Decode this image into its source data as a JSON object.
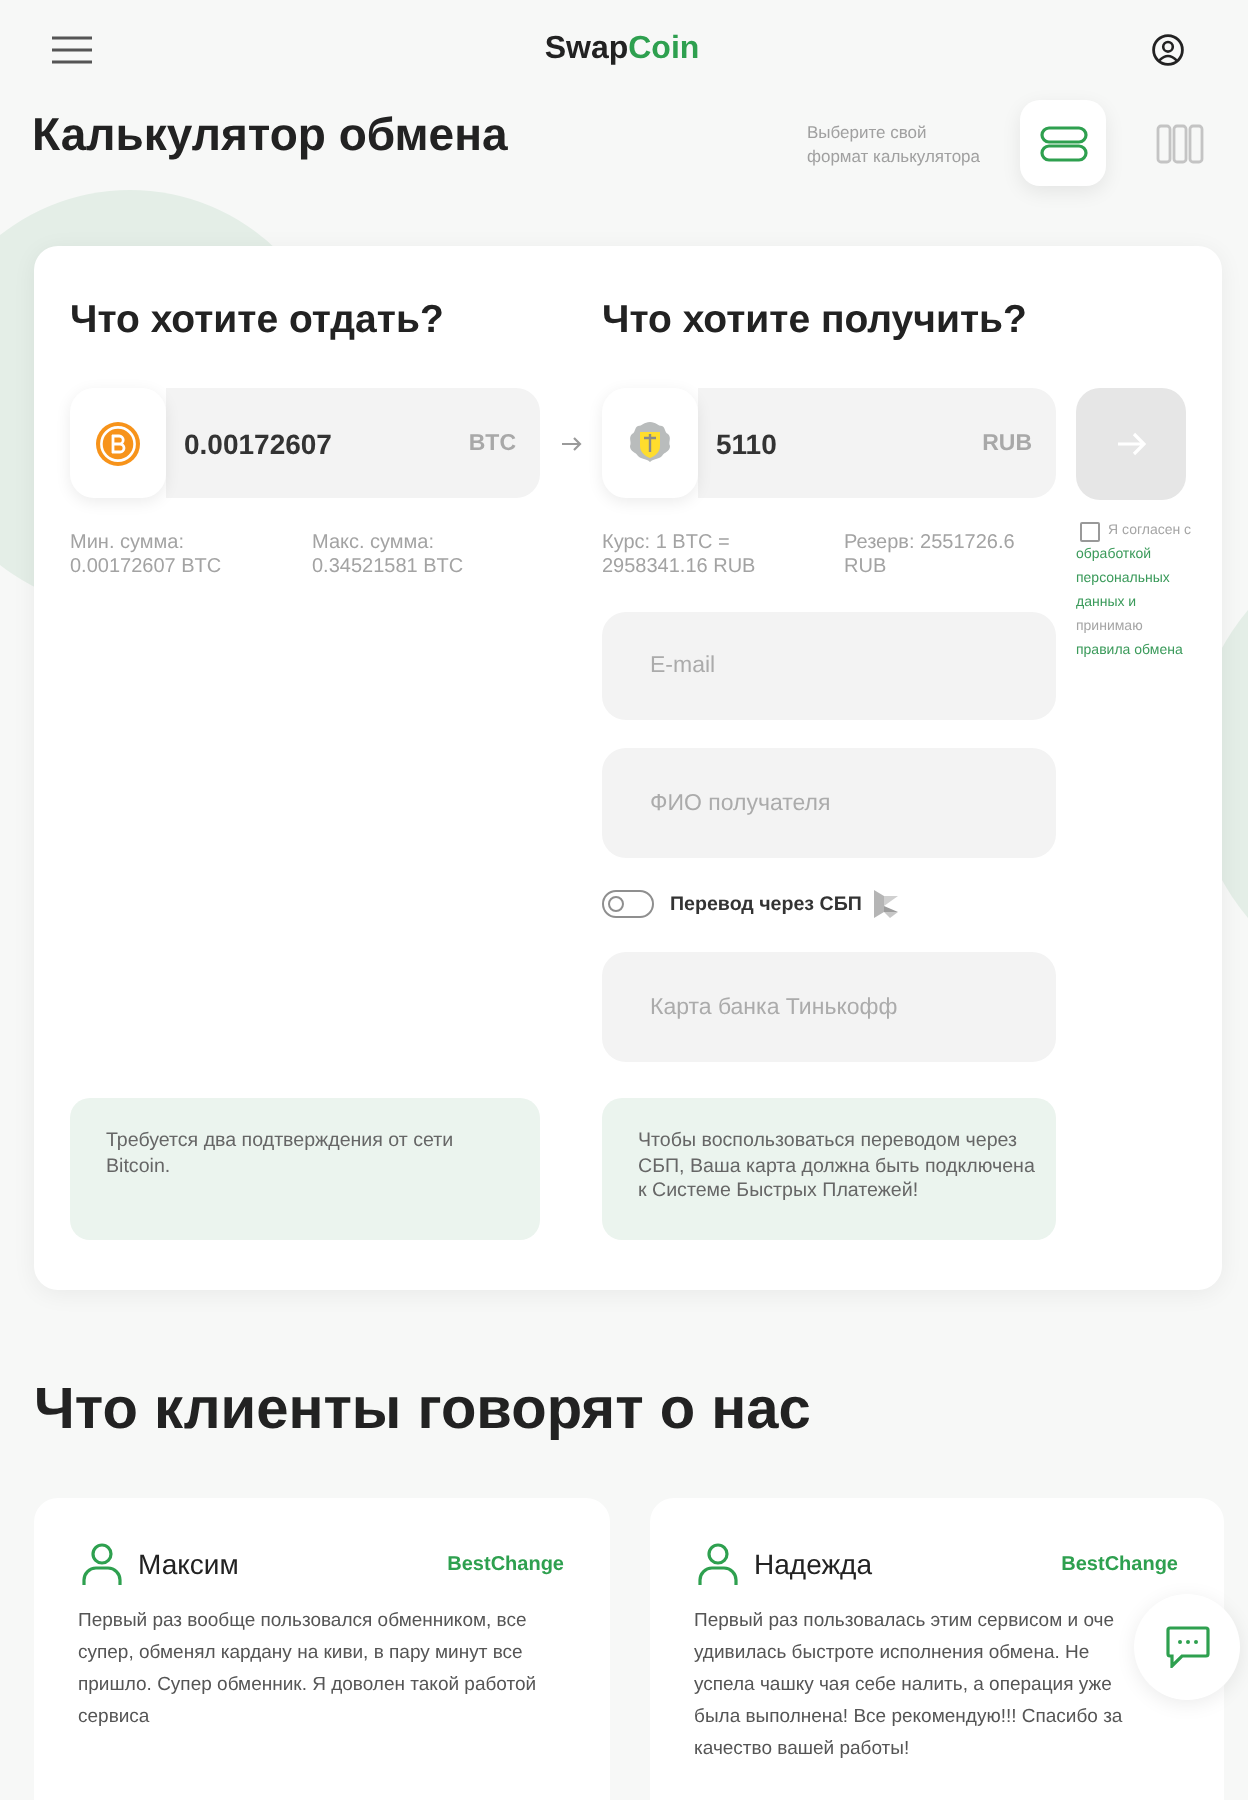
{
  "header": {
    "logo": {
      "plain_part": "Swap",
      "accent_part": "Coin"
    }
  },
  "page_title": "Калькулятор обмена",
  "format_switch": {
    "hint": "Выберите свой\nформат калькулятора",
    "options": [
      {
        "kind": "rows",
        "selected": true
      },
      {
        "kind": "columns",
        "selected": false
      }
    ]
  },
  "calculator": {
    "give": {
      "title": "Что хотите отдать?",
      "amount": "0.00172607",
      "currency": "BTC",
      "limits": [
        "Мин. сумма:\n0.00172607 BTC",
        "Макс. сумма:\n0.34521581 BTC"
      ],
      "note": "Требуется два подтверждения от сети Bitcoin."
    },
    "get": {
      "title": "Что хотите получить?",
      "amount": "5110",
      "currency": "RUB",
      "rates": [
        "Курс: 1 BTC =\n2958341.16 RUB",
        "Резерв: 2551726.6\nRUB"
      ],
      "fields": [
        {
          "placeholder": "E-mail"
        },
        {
          "placeholder": "ФИО получателя"
        }
      ],
      "sbp_toggle": {
        "label": "Перевод через СБП",
        "on": false
      },
      "card_field": {
        "placeholder": "Карта банка Тинькофф"
      },
      "note": "Чтобы воспользоваться переводом через СБП, Ваша карта должна быть подключена к Системе Быстрых Платежей!"
    },
    "submit": {
      "disabled": true
    },
    "consent": {
      "checked": false,
      "text_before": "Я согласен с",
      "link_1": "обработкой персональных данных и",
      "text_middle": "принимаю",
      "link_2": "правила обмена"
    }
  },
  "reviews": {
    "title": "Что клиенты говорят о нас",
    "items": [
      {
        "name": "Максим",
        "source": "BestChange",
        "text": "Первый раз вообще пользовался обменником, все супер, обменял кардану на киви, в пару минут все пришло. Супер обменник. Я доволен такой работой сервиса"
      },
      {
        "name": "Надежда",
        "source": "BestChange",
        "text": "Первый раз пользовалась этим сервисом и оче удивилась быстроте исполнения обмена. Не успела чашку чая себе налить, а операция уже была выполнена! Все рекомендую!!! Спасибо за качество вашей работы!"
      }
    ]
  }
}
